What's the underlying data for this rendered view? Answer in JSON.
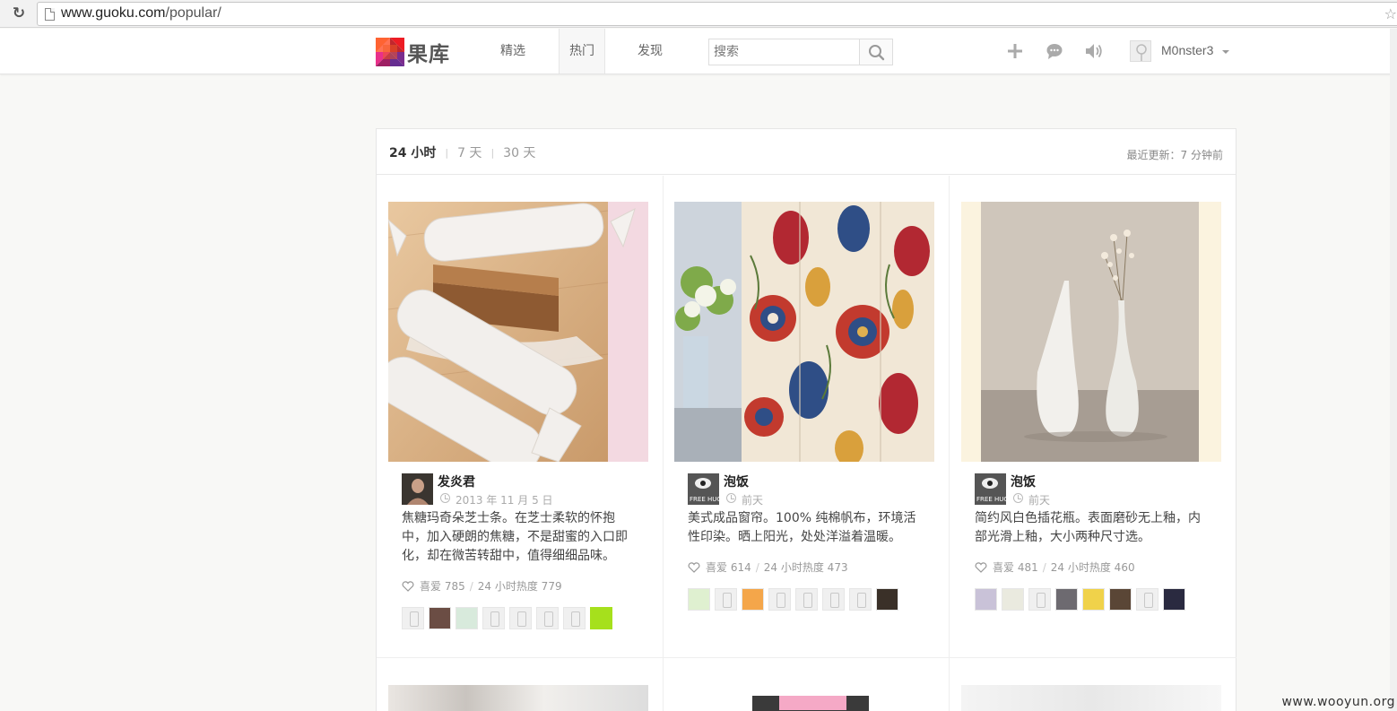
{
  "browser": {
    "url_host": "www.guoku.com",
    "url_path": "/popular/"
  },
  "header": {
    "logo_text": "果库",
    "nav": [
      {
        "label": "精选",
        "active": false
      },
      {
        "label": "热门",
        "active": true
      },
      {
        "label": "发现",
        "active": false
      }
    ],
    "search_placeholder": "搜索",
    "username": "M0nster3",
    "icons": [
      "plus-icon",
      "message-icon",
      "speaker-icon"
    ]
  },
  "filter": {
    "tabs": [
      "24 小时",
      "7 天",
      "30 天"
    ],
    "active_tab": "24 小时",
    "last_update": "最近更新：7 分钟前"
  },
  "items": [
    {
      "author": "发炎君",
      "date": "2013 年 11 月 5 日",
      "description": "焦糖玛奇朵芝士条。在芝士柔软的怀抱中，加入硬朗的焦糖，不是甜蜜的入口即化，却在微苦转甜中，值得细细品味。",
      "likes": "喜爱 785",
      "heat": "24 小时热度 779",
      "liker_count": 8
    },
    {
      "author": "泡饭",
      "date": "前天",
      "description": "美式成品窗帘。100% 纯棉帆布，环境活性印染。晒上阳光，处处洋溢着温暖。",
      "likes": "喜爱 614",
      "heat": "24 小时热度 473",
      "liker_count": 8
    },
    {
      "author": "泡饭",
      "date": "前天",
      "description": "简约风白色插花瓶。表面磨砂无上釉，内部光滑上釉，大小两种尺寸选。",
      "likes": "喜爱 481",
      "heat": "24 小时热度 460",
      "liker_count": 8
    }
  ],
  "avatar_badge_text": "FREE HUGS",
  "watermark": "www.wooyun.org",
  "colors": {
    "page_bg": "#f8f8f6",
    "panel_bg": "#ffffff",
    "accent_green": "#a6e01c"
  }
}
